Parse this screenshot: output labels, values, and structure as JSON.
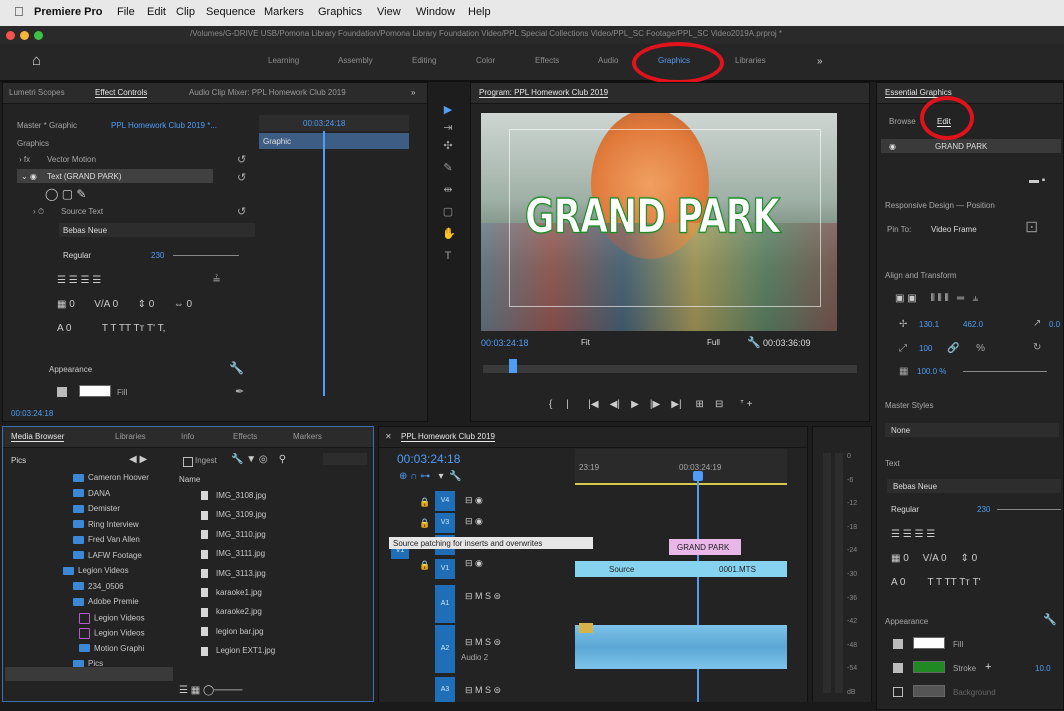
{
  "menubar": {
    "app_name": "Premiere Pro",
    "items": [
      "File",
      "Edit",
      "Clip",
      "Sequence",
      "Markers",
      "Graphics",
      "View",
      "Window",
      "Help"
    ]
  },
  "titlebar": {
    "path": "/Volumes/G-DRIVE USB/Pomona Library Foundation/Pomona Library Foundation Video/PPL Special Collections Video/PPL_SC Footage/PPL_SC Video2019A.prproj *"
  },
  "workspaces": {
    "items": [
      "Learning",
      "Assembly",
      "Editing",
      "Color",
      "Effects",
      "Audio",
      "Graphics",
      "Libraries"
    ],
    "active": "Graphics",
    "more": "»"
  },
  "effect_controls": {
    "tabs": [
      "Lumetri Scopes",
      "Effect Controls",
      "Audio Clip Mixer: PPL Homework Club 2019"
    ],
    "master": "Master * Graphic",
    "sequence": "PPL Homework Club 2019 *...",
    "timecode_top": "00:03:24:18",
    "clip_label": "Graphic",
    "section": "Graphics",
    "vector_motion": "Vector Motion",
    "text_layer": "Text (GRAND PARK)",
    "source_text": "Source Text",
    "font": "Bebas Neue",
    "style": "Regular",
    "size": "230",
    "appearance": "Appearance",
    "fill_label": "Fill",
    "timecode_bottom": "00:03:24:18"
  },
  "program_monitor": {
    "title": "Program: PPL Homework Club 2019",
    "title_text": "GRAND PARK",
    "timecode_current": "00:03:24:18",
    "fit": "Fit",
    "quality": "Full",
    "timecode_total": "00:03:36:09"
  },
  "essential_graphics": {
    "title": "Essential Graphics",
    "tabs": [
      "Browse",
      "Edit"
    ],
    "layer_name": "GRAND PARK",
    "responsive_label": "Responsive Design — Position",
    "pin_to": "Pin To:",
    "pin_target": "Video Frame",
    "align_label": "Align and Transform",
    "pos_x": "130.1",
    "pos_y": "462.0",
    "rotation": "0.0",
    "scale_w": "100",
    "opacity": "100.0 %",
    "master_styles": "Master Styles",
    "master_style_value": "None",
    "text_section": "Text",
    "font": "Bebas Neue",
    "style": "Regular",
    "size": "230",
    "appearance": "Appearance",
    "fill": "Fill",
    "stroke": "Stroke",
    "stroke_width": "10.0",
    "background": "Background"
  },
  "media_browser": {
    "tabs": [
      "Media Browser",
      "Libraries",
      "Info",
      "Effects",
      "Markers"
    ],
    "location": "Pics",
    "ingest": "Ingest",
    "name_header": "Name",
    "folders": [
      "Cameron Hoover",
      "DANA",
      "Demister",
      "Ring Interview",
      "Fred Van Allen",
      "LAFW Footage",
      "Legion Videos",
      "234_0506",
      "Adobe Premie",
      "Legion Videos",
      "Legion Videos",
      "Motion Graphi",
      "Pics"
    ],
    "files": [
      "IMG_3108.jpg",
      "IMG_3109.jpg",
      "IMG_3110.jpg",
      "IMG_3111.jpg",
      "IMG_3113.jpg",
      "karaoke1.jpg",
      "karaoke2.jpg",
      "legion bar.jpg",
      "Legion EXT1.jpg"
    ]
  },
  "timeline": {
    "title": "PPL Homework Club 2019",
    "timecode": "00:03:24:18",
    "ruler_left": "23:19",
    "ruler_mid": "00:03:24:19",
    "tooltip": "Source patching for inserts and overwrites",
    "clip_graphic": "GRAND PARK",
    "clip_video_a": "Source",
    "clip_video_b": "0001.MTS",
    "audio_label": "Audio 2",
    "tracks": [
      "V4",
      "V3",
      "V2",
      "V1",
      "A1",
      "A2",
      "A3"
    ],
    "source_v1": "V1"
  },
  "meter_scale": [
    "0",
    "-6",
    "-12",
    "-18",
    "-24",
    "-30",
    "-36",
    "-42",
    "-48",
    "-54",
    "dB"
  ],
  "colors": {
    "accent_blue": "#4f9df5",
    "highlight_red": "#e0121b",
    "clip_pink": "#e9b6e8",
    "clip_cyan": "#86d3f0",
    "audio_blue": "#7ec3ea",
    "stroke_green": "#1f8a23"
  }
}
